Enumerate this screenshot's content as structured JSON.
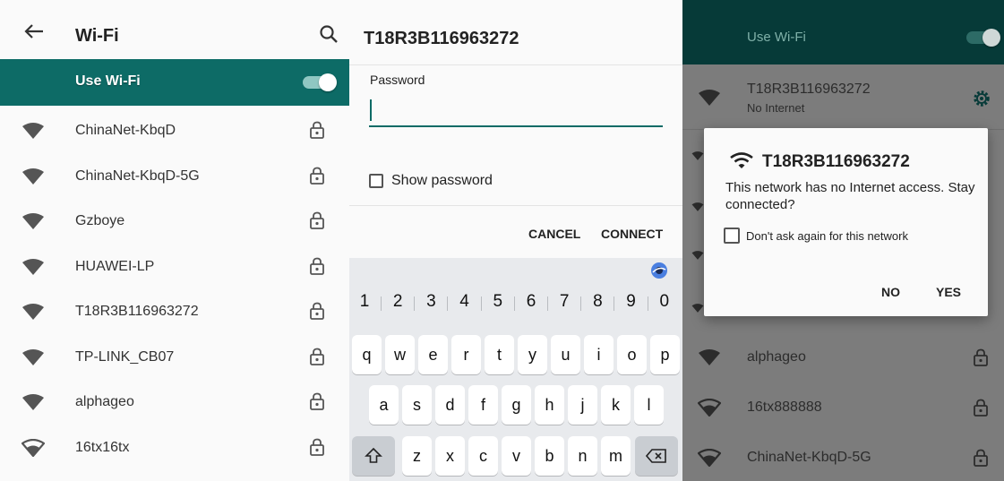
{
  "colors": {
    "accent": "#0d6b66",
    "accent_dark": "#063a38",
    "overlay": "#7c7c7c"
  },
  "panel1": {
    "title": "Wi-Fi",
    "toggle_label": "Use Wi-Fi",
    "networks": [
      {
        "name": "ChinaNet-KbqD",
        "icon": "wifi-signal-icon",
        "locked": true
      },
      {
        "name": "ChinaNet-KbqD-5G",
        "icon": "wifi-signal-icon",
        "locked": true
      },
      {
        "name": "Gzboye",
        "icon": "wifi-signal-icon",
        "locked": true
      },
      {
        "name": "HUAWEI-LP",
        "icon": "wifi-signal-icon",
        "locked": true
      },
      {
        "name": "T18R3B116963272",
        "icon": "wifi-signal-icon",
        "locked": true
      },
      {
        "name": "TP-LINK_CB07",
        "icon": "wifi-signal-icon",
        "locked": true
      },
      {
        "name": "alphageo",
        "icon": "wifi-signal-icon",
        "locked": true
      },
      {
        "name": "16tx16tx",
        "icon": "wifi-weak-signal-icon",
        "locked": true
      }
    ]
  },
  "panel2": {
    "title": "T18R3B116963272",
    "password_label": "Password",
    "password_value": "",
    "show_password_label": "Show password",
    "cancel_label": "CANCEL",
    "connect_label": "CONNECT",
    "keyboard": {
      "numbers": [
        "1",
        "2",
        "3",
        "4",
        "5",
        "6",
        "7",
        "8",
        "9",
        "0"
      ],
      "row1": [
        "q",
        "w",
        "e",
        "r",
        "t",
        "y",
        "u",
        "i",
        "o",
        "p"
      ],
      "row2": [
        "a",
        "s",
        "d",
        "f",
        "g",
        "h",
        "j",
        "k",
        "l"
      ],
      "row3": [
        "z",
        "x",
        "c",
        "v",
        "b",
        "n",
        "m"
      ],
      "shift_icon": "shift-icon",
      "backspace_icon": "backspace-icon"
    }
  },
  "panel3": {
    "use_wifi_label": "Use Wi-Fi",
    "connected_network": {
      "name": "T18R3B116963272",
      "status": "No Internet"
    },
    "dialog": {
      "title": "T18R3B116963272",
      "message": "This network has no Internet access. Stay connected?",
      "checkbox_label": "Don't ask again for this network",
      "no_label": "NO",
      "yes_label": "YES"
    },
    "networks": [
      {
        "name": "alphageo",
        "icon": "wifi-signal-icon",
        "locked": true
      },
      {
        "name": "16tx888888",
        "icon": "wifi-weak-signal-icon",
        "locked": true
      },
      {
        "name": "ChinaNet-KbqD-5G",
        "icon": "wifi-weak-signal-icon",
        "locked": true
      }
    ]
  }
}
